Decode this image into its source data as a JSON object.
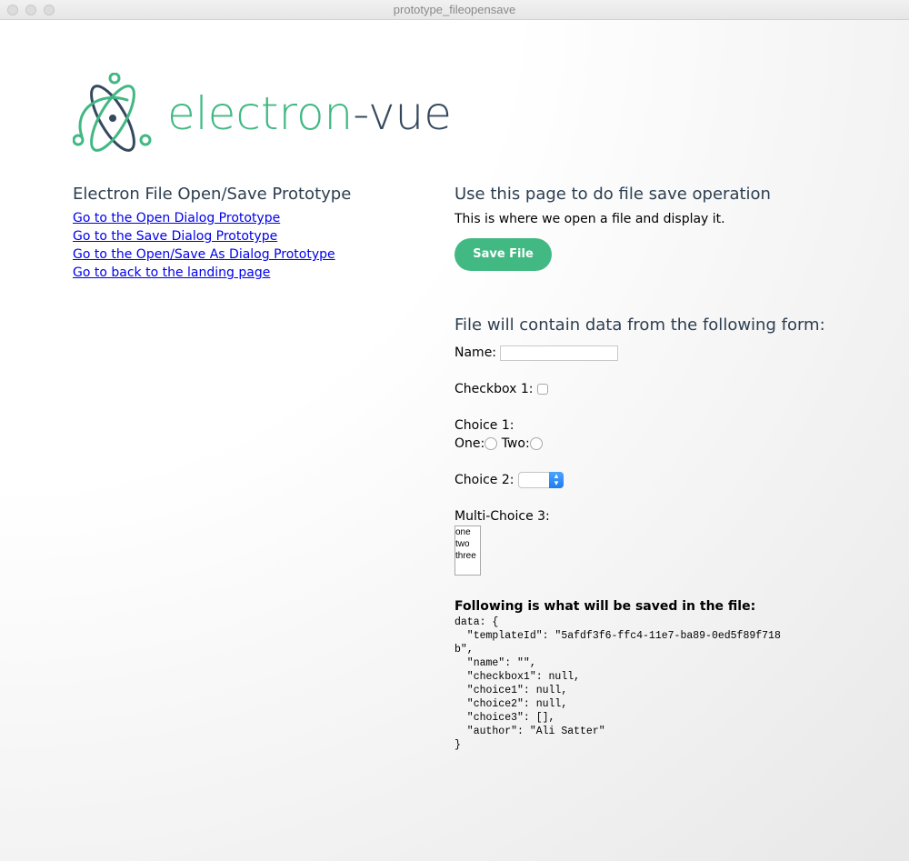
{
  "window": {
    "title": "prototype_fileopensave"
  },
  "logo": {
    "text_part1": "electron",
    "text_part2": "-vue"
  },
  "left": {
    "heading": "Electron File Open/Save Prototype",
    "links": [
      "Go to the Open Dialog Prototype",
      "Go to the Save Dialog Prototype",
      "Go to the Open/Save As Dialog Prototype",
      "Go to back to the landing page"
    ]
  },
  "right": {
    "heading": "Use this page to do file save operation",
    "description": "This is where we open a file and display it.",
    "save_button": "Save File",
    "form_heading": "File will contain data from the following form:",
    "form": {
      "name_label": "Name:",
      "name_value": "",
      "checkbox_label": "Checkbox 1:",
      "choice1_label": "Choice 1:",
      "radio_one_label": "One:",
      "radio_two_label": "Two:",
      "choice2_label": "Choice 2:",
      "multi_label": "Multi-Choice 3:",
      "multi_options": [
        "one",
        "two",
        "three"
      ]
    },
    "saved_heading": "Following is what will be saved in the file:",
    "saved_code": "data: {\n  \"templateId\": \"5afdf3f6-ffc4-11e7-ba89-0ed5f89f718\nb\",\n  \"name\": \"\",\n  \"checkbox1\": null,\n  \"choice1\": null,\n  \"choice2\": null,\n  \"choice3\": [],\n  \"author\": \"Ali Satter\"\n}"
  },
  "colors": {
    "brand_green": "#41b883",
    "brand_dark": "#35495e",
    "button": "#42b983",
    "link": "#0000ee"
  }
}
